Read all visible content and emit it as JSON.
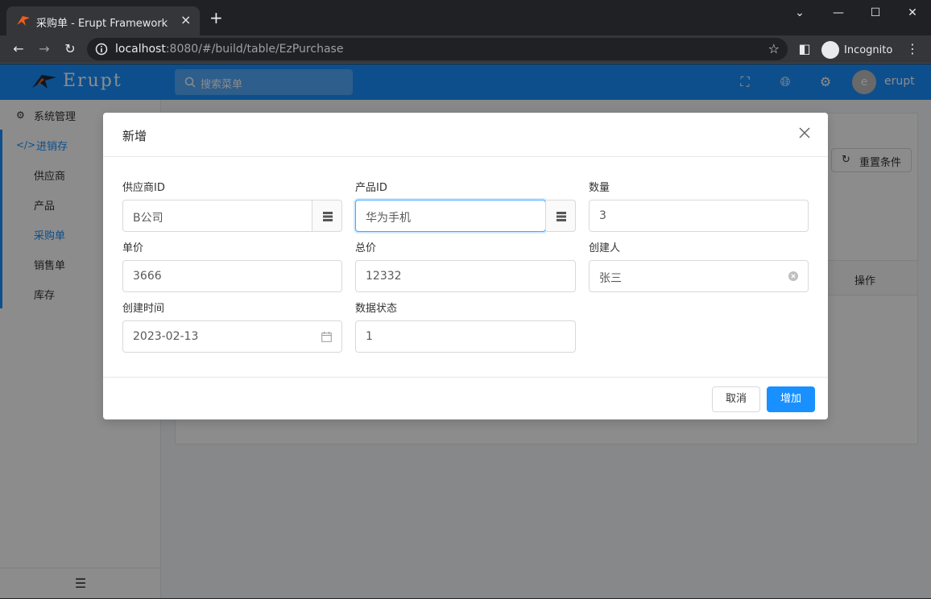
{
  "browser": {
    "tab_title": "采购单 - Erupt Framework",
    "url_host": "localhost",
    "url_rest": ":8080/#/build/table/EzPurchase",
    "profile_label": "Incognito"
  },
  "app": {
    "logo_text": "Erupt",
    "search_placeholder": "搜索菜单",
    "user_initial": "e",
    "user_name": "erupt"
  },
  "sidebar": {
    "items": [
      {
        "label": "系统管理"
      },
      {
        "label": "进销存"
      },
      {
        "label": "供应商"
      },
      {
        "label": "产品"
      },
      {
        "label": "采购单"
      },
      {
        "label": "销售单"
      },
      {
        "label": "库存"
      }
    ]
  },
  "page": {
    "reset_button": "重置条件",
    "column_action": "操作"
  },
  "modal": {
    "title": "新增",
    "fields": {
      "supplier": {
        "label": "供应商ID",
        "value": "B公司"
      },
      "product": {
        "label": "产品ID",
        "value": "华为手机"
      },
      "quantity": {
        "label": "数量",
        "value": "3"
      },
      "unit_price": {
        "label": "单价",
        "value": "3666"
      },
      "total_price": {
        "label": "总价",
        "value": "12332"
      },
      "creator": {
        "label": "创建人",
        "value": "张三"
      },
      "create_time": {
        "label": "创建时间",
        "value": "2023-02-13"
      },
      "status": {
        "label": "数据状态",
        "value": "1"
      }
    },
    "cancel_label": "取消",
    "submit_label": "增加"
  },
  "colors": {
    "accent": "#1890ff",
    "header": "#1890ff",
    "mask": "rgba(0,0,0,0.45)"
  }
}
